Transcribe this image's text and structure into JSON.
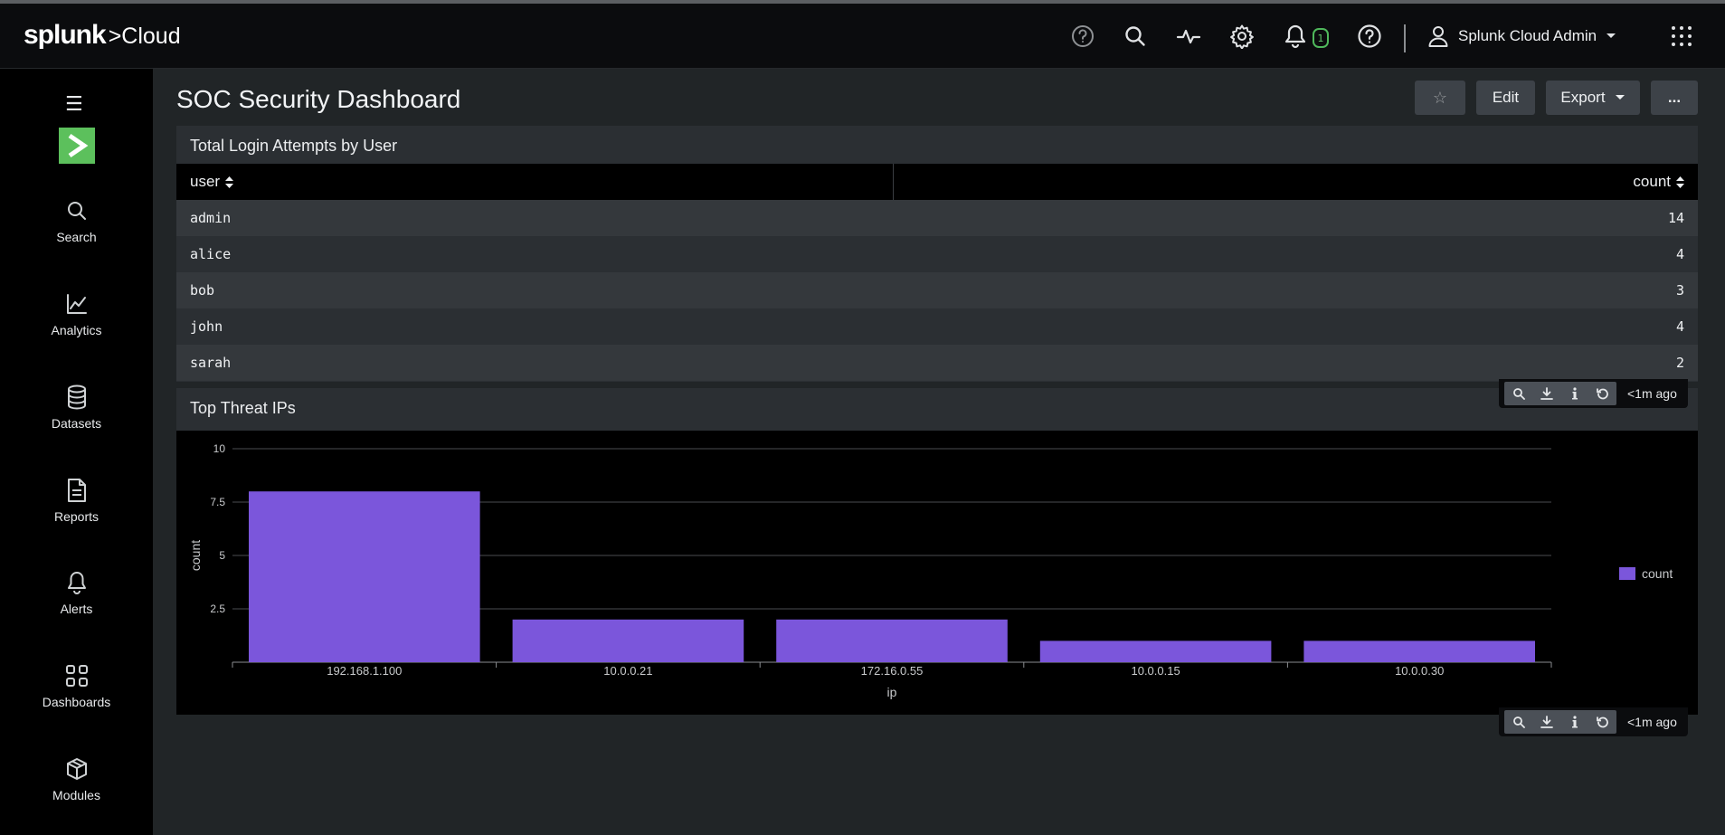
{
  "app": {
    "logo_brand": "splunk",
    "logo_product": ">Cloud"
  },
  "topbar": {
    "icons": [
      "help-circle-icon",
      "search-icon",
      "activity-icon",
      "gear-icon",
      "bell-icon",
      "help-circle-icon"
    ],
    "notification_count": "1",
    "user_name": "Splunk Cloud Admin"
  },
  "sidebar": {
    "items": [
      {
        "label": "Search",
        "icon": "search-icon"
      },
      {
        "label": "Analytics",
        "icon": "line-chart-icon"
      },
      {
        "label": "Datasets",
        "icon": "database-icon"
      },
      {
        "label": "Reports",
        "icon": "report-icon"
      },
      {
        "label": "Alerts",
        "icon": "bell-icon"
      },
      {
        "label": "Dashboards",
        "icon": "dashboard-icon"
      },
      {
        "label": "Modules",
        "icon": "modules-icon"
      }
    ]
  },
  "page": {
    "title": "SOC Security Dashboard",
    "buttons": {
      "favorite": "☆",
      "edit": "Edit",
      "export": "Export",
      "more": "..."
    }
  },
  "login_panel": {
    "title": "Total Login Attempts by User",
    "columns": [
      "user",
      "count"
    ],
    "rows": [
      {
        "user": "admin",
        "count": "14"
      },
      {
        "user": "alice",
        "count": "4"
      },
      {
        "user": "bob",
        "count": "3"
      },
      {
        "user": "john",
        "count": "4"
      },
      {
        "user": "sarah",
        "count": "2"
      }
    ],
    "updated": "<1m ago"
  },
  "threat_panel": {
    "title": "Top Threat IPs",
    "updated": "<1m ago"
  },
  "colors": {
    "bar": "#7b56db",
    "accent_green": "#5cc05c"
  },
  "chart_data": {
    "type": "bar",
    "categories": [
      "192.168.1.100",
      "10.0.0.21",
      "172.16.0.55",
      "10.0.0.15",
      "10.0.0.30"
    ],
    "series": [
      {
        "name": "count",
        "values": [
          8,
          2,
          2,
          1,
          1
        ]
      }
    ],
    "xlabel": "ip",
    "ylabel": "count",
    "ylim": [
      0,
      10
    ],
    "yticks": [
      0,
      2.5,
      5,
      7.5,
      10
    ],
    "ytick_labels": [
      "",
      "2.5",
      "5",
      "7.5",
      "10"
    ],
    "grid": true,
    "legend_position": "right"
  }
}
